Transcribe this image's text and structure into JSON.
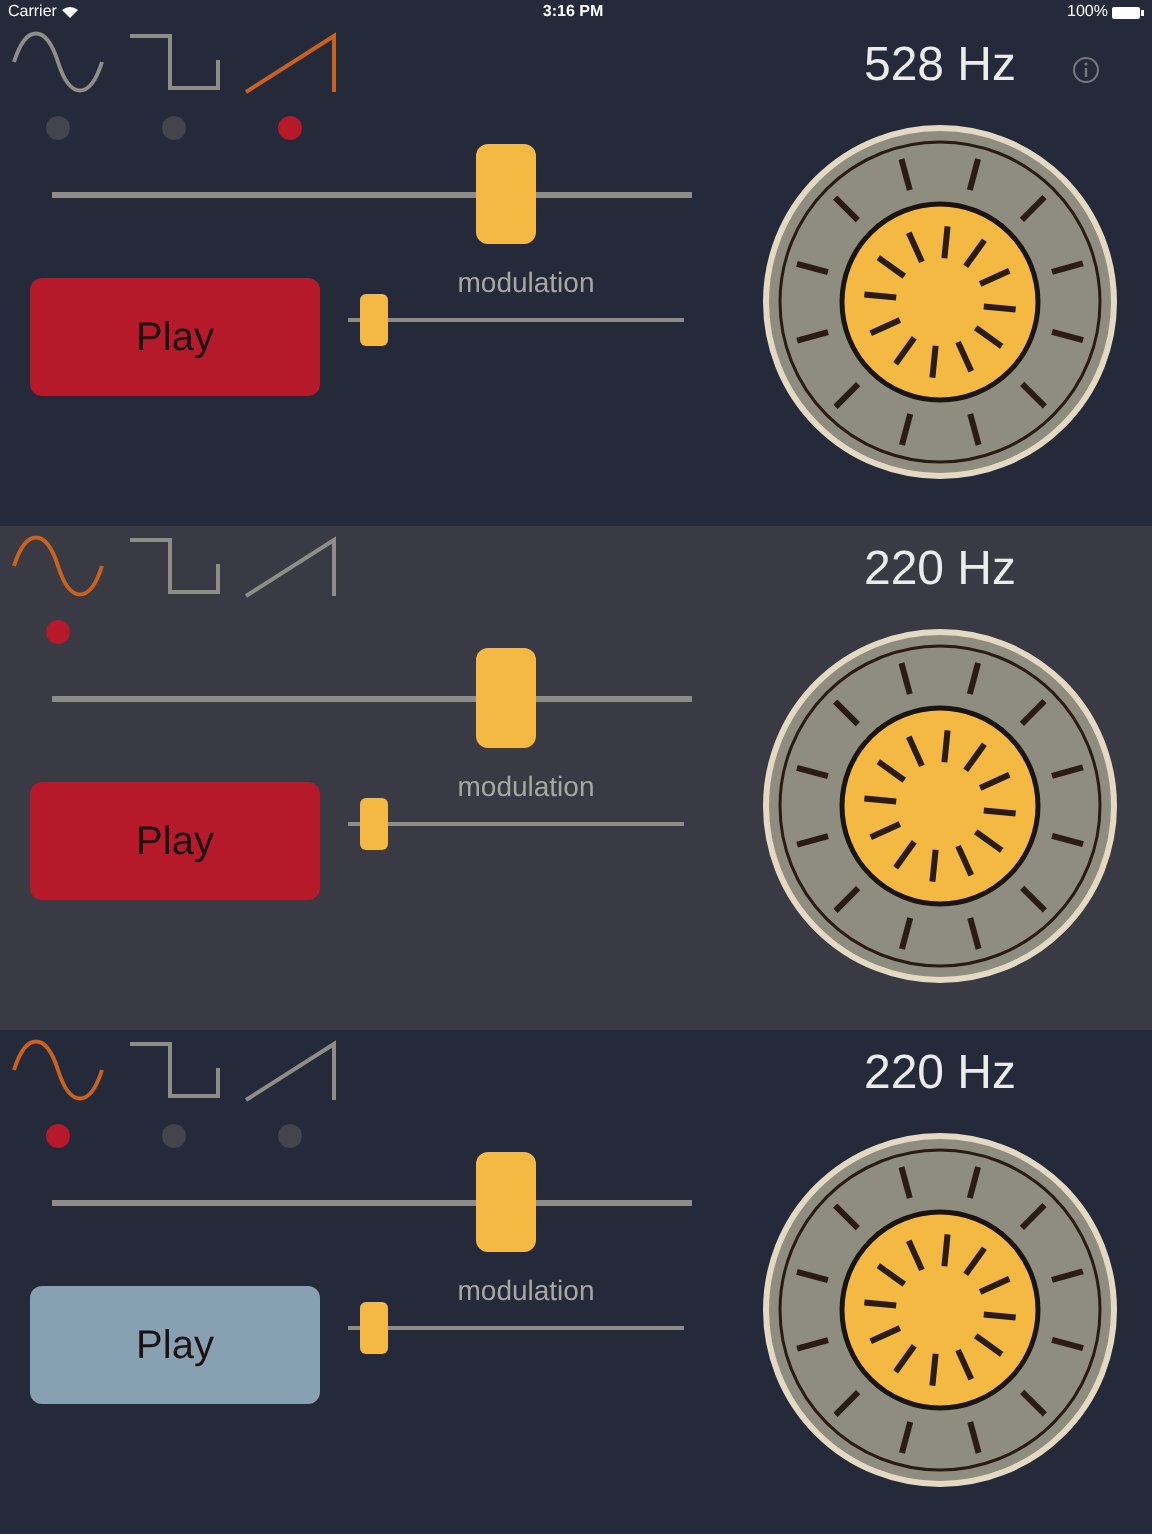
{
  "status_bar": {
    "carrier": "Carrier",
    "time": "3:16 PM",
    "battery": "100%"
  },
  "panels": [
    {
      "highlighted": false,
      "frequency": "528 Hz",
      "info": true,
      "unselected_dots": true,
      "waveforms": [
        {
          "kind": "sine",
          "selected": false
        },
        {
          "kind": "square",
          "selected": false
        },
        {
          "kind": "sawtooth",
          "selected": true
        }
      ],
      "frequency_slider": {
        "level": 0.71
      },
      "play_button": {
        "label": "Play",
        "playing": true
      },
      "modulation": {
        "label": "modulation",
        "level": 0.04
      }
    },
    {
      "highlighted": true,
      "frequency": "220 Hz",
      "info": false,
      "unselected_dots": false,
      "waveforms": [
        {
          "kind": "sine",
          "selected": true
        },
        {
          "kind": "square",
          "selected": false
        },
        {
          "kind": "sawtooth",
          "selected": false
        }
      ],
      "frequency_slider": {
        "level": 0.71
      },
      "play_button": {
        "label": "Play",
        "playing": true
      },
      "modulation": {
        "label": "modulation",
        "level": 0.04
      }
    },
    {
      "highlighted": false,
      "frequency": "220 Hz",
      "info": false,
      "unselected_dots": true,
      "waveforms": [
        {
          "kind": "sine",
          "selected": true
        },
        {
          "kind": "square",
          "selected": false
        },
        {
          "kind": "sawtooth",
          "selected": false
        }
      ],
      "frequency_slider": {
        "level": 0.71
      },
      "play_button": {
        "label": "Play",
        "playing": false
      },
      "modulation": {
        "label": "modulation",
        "level": 0.04
      }
    }
  ]
}
